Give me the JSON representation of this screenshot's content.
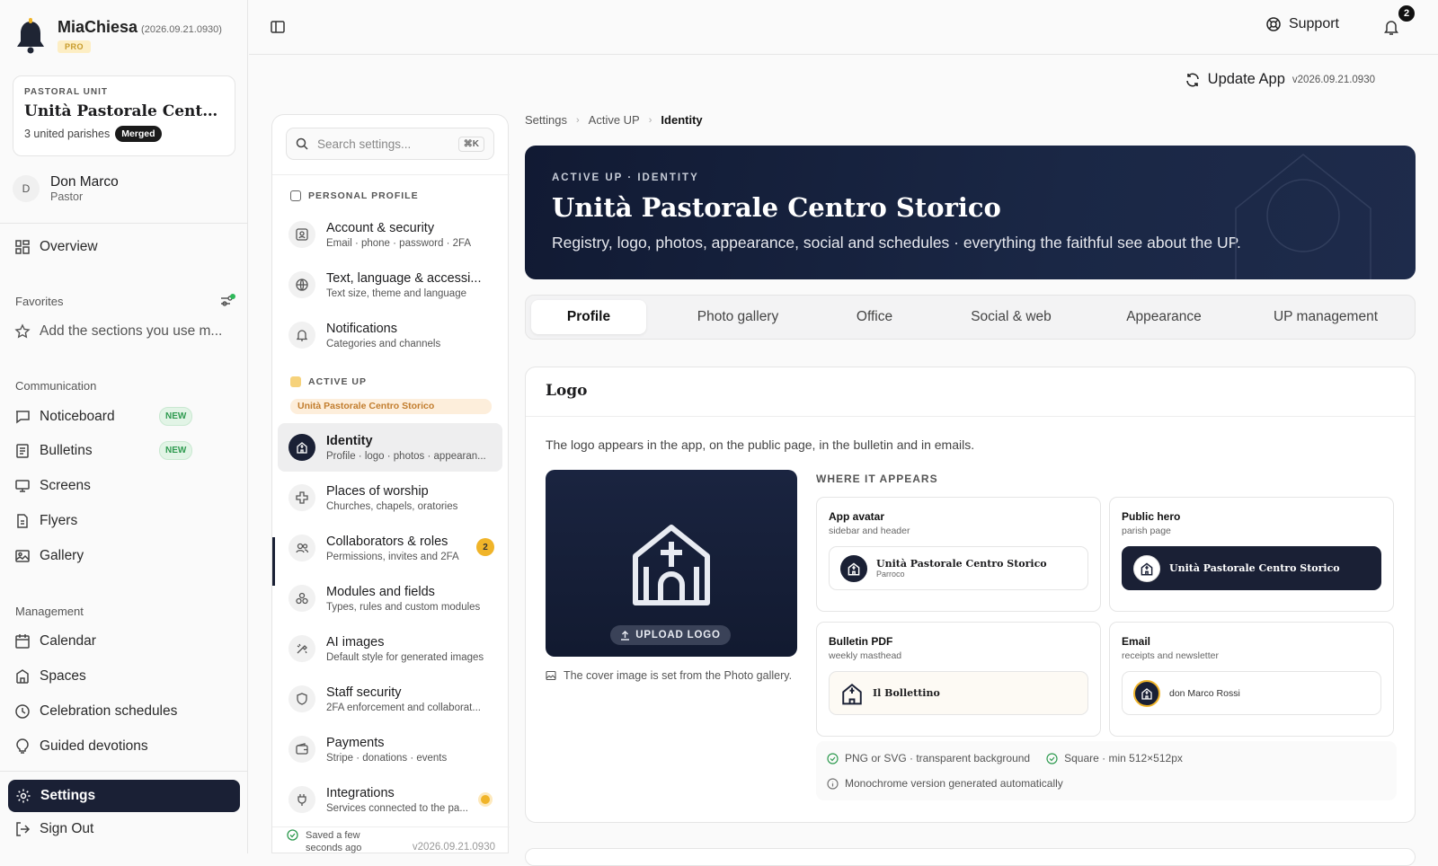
{
  "app": {
    "name": "MiaChiesa",
    "version": "(2026.09.21.0930)",
    "plan": "PRO"
  },
  "unit": {
    "kicker": "PASTORAL UNIT",
    "name": "Unità Pastorale Centro Sto...",
    "parishes": "3 united parishes",
    "badge": "Merged"
  },
  "user": {
    "initial": "D",
    "name": "Don Marco",
    "role": "Pastor"
  },
  "nav": {
    "overview": "Overview",
    "favorites_title": "Favorites",
    "favorites_add": "Add the sections you use m...",
    "communication": "Communication",
    "noticeboard": "Noticeboard",
    "bulletins": "Bulletins",
    "new_badge": "NEW",
    "screens": "Screens",
    "flyers": "Flyers",
    "gallery": "Gallery",
    "management": "Management",
    "calendar": "Calendar",
    "spaces": "Spaces",
    "celebration": "Celebration schedules",
    "devotions": "Guided devotions",
    "settings": "Settings",
    "signout": "Sign Out"
  },
  "topbar": {
    "support": "Support",
    "notifications": "2",
    "update": "Update App",
    "update_version": "v2026.09.21.0930"
  },
  "settings_panel": {
    "search_placeholder": "Search settings...",
    "search_kbd": "⌘K",
    "personal_header": "PERSONAL PROFILE",
    "items_personal": [
      {
        "title": "Account & security",
        "sub": "Email · phone · password · 2FA"
      },
      {
        "title": "Text, language & accessi...",
        "sub": "Text size, theme and language"
      },
      {
        "title": "Notifications",
        "sub": "Categories and channels"
      }
    ],
    "active_header": "ACTIVE UP",
    "active_tag": "Unità Pastorale Centro Storico",
    "items_up": [
      {
        "title": "Identity",
        "sub": "Profile · logo · photos · appearan..."
      },
      {
        "title": "Places of worship",
        "sub": "Churches, chapels, oratories"
      },
      {
        "title": "Collaborators & roles",
        "sub": "Permissions, invites and 2FA",
        "count": "2"
      },
      {
        "title": "Modules and fields",
        "sub": "Types, rules and custom modules"
      },
      {
        "title": "AI images",
        "sub": "Default style for generated images"
      },
      {
        "title": "Staff security",
        "sub": "2FA enforcement and collaborat..."
      },
      {
        "title": "Payments",
        "sub": "Stripe · donations · events"
      },
      {
        "title": "Integrations",
        "sub": "Services connected to the pa..."
      }
    ],
    "saved": "Saved a few\nseconds ago",
    "version": "v2026.09.21.0930"
  },
  "breadcrumb": [
    "Settings",
    "Active UP",
    "Identity"
  ],
  "hero": {
    "kicker": "ACTIVE UP · IDENTITY",
    "title": "Unità Pastorale Centro Storico",
    "subtitle": "Registry, logo, photos, appearance, social and schedules · everything the faithful see about the UP."
  },
  "tabs": [
    "Profile",
    "Photo gallery",
    "Office",
    "Social & web",
    "Appearance",
    "UP management"
  ],
  "logo_card": {
    "title": "Logo",
    "desc": "The logo appears in the app, on the public page, in the bulletin and in emails.",
    "upload": "UPLOAD LOGO",
    "cover_note": "The cover image is set from the Photo gallery.",
    "where_title": "WHERE IT APPEARS",
    "places": [
      {
        "title": "App avatar",
        "sub": "sidebar and header",
        "preview": "Unità Pastorale Centro Storico",
        "preview_sub": "Parroco"
      },
      {
        "title": "Public hero",
        "sub": "parish page",
        "preview": "Unità Pastorale Centro Storico"
      },
      {
        "title": "Bulletin PDF",
        "sub": "weekly masthead",
        "preview": "Il Bollettino"
      },
      {
        "title": "Email",
        "sub": "receipts and newsletter",
        "preview": "don Marco Rossi"
      }
    ],
    "requirements": [
      "PNG or SVG · transparent background",
      "Square · min 512×512px",
      "Monochrome version generated automatically"
    ]
  }
}
